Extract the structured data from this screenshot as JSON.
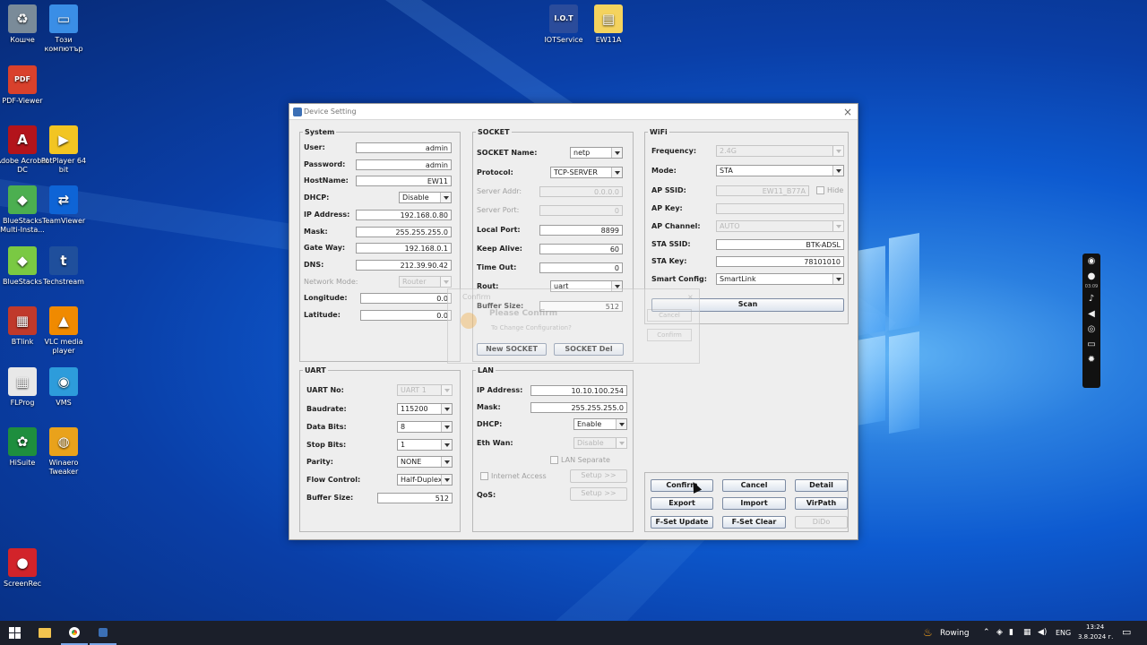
{
  "desktop_icons": [
    {
      "label": "Кошче",
      "color": "#7a8b99",
      "glyph": "♻"
    },
    {
      "label": "Този компютър",
      "color": "#3a8ee6",
      "glyph": "▭"
    },
    {
      "label": "PDF-Viewer",
      "color": "#d9412c",
      "glyph": "PDF"
    },
    {
      "label": "Adobe Acrobat DC",
      "color": "#b3141b",
      "glyph": "A"
    },
    {
      "label": "PotPlayer 64 bit",
      "color": "#f2c522",
      "glyph": "▶"
    },
    {
      "label": "BlueStacks Multi-Insta...",
      "color": "#4caf50",
      "glyph": "◆"
    },
    {
      "label": "TeamViewer",
      "color": "#0e64d6",
      "glyph": "⇄"
    },
    {
      "label": "BlueStacks",
      "color": "#7ac943",
      "glyph": "◆"
    },
    {
      "label": "Techstream",
      "color": "#1f4f9c",
      "glyph": "t"
    },
    {
      "label": "BTlink",
      "color": "#c0392b",
      "glyph": "▦"
    },
    {
      "label": "VLC media player",
      "color": "#f08a00",
      "glyph": "▲"
    },
    {
      "label": "FLProg",
      "color": "#e8e8e8",
      "glyph": "▦"
    },
    {
      "label": "VMS",
      "color": "#2d9cdb",
      "glyph": "◉"
    },
    {
      "label": "HiSuite",
      "color": "#1e8e3e",
      "glyph": "✿"
    },
    {
      "label": "Winaero Tweaker",
      "color": "#e9a21b",
      "glyph": "◍"
    },
    {
      "label": "ScreenRec",
      "color": "#d2232a",
      "glyph": "●"
    },
    {
      "label": "IOTService",
      "color": "#2b4c9b",
      "glyph": "I.O.T"
    },
    {
      "label": "EW11A",
      "color": "#f4d35e",
      "glyph": "▤"
    }
  ],
  "dialog": {
    "title": "Device Setting",
    "system": {
      "title": "System",
      "user_label": "User:",
      "user": "admin",
      "password_label": "Password:",
      "password": "admin",
      "hostname_label": "HostName:",
      "hostname": "EW11",
      "dhcp_label": "DHCP:",
      "dhcp": "Disable",
      "ip_label": "IP Address:",
      "ip": "192.168.0.80",
      "mask_label": "Mask:",
      "mask": "255.255.255.0",
      "gateway_label": "Gate Way:",
      "gateway": "192.168.0.1",
      "dns_label": "DNS:",
      "dns": "212.39.90.42",
      "network_mode_label": "Network Mode:",
      "network_mode": "Router",
      "longitude_label": "Longitude:",
      "longitude": "0.0",
      "latitude_label": "Latitude:",
      "latitude": "0.0"
    },
    "socket": {
      "title": "SOCKET",
      "name_label": "SOCKET Name:",
      "name": "netp",
      "protocol_label": "Protocol:",
      "protocol": "TCP-SERVER",
      "server_addr_label": "Server Addr:",
      "server_addr": "0.0.0.0",
      "server_port_label": "Server Port:",
      "server_port": "0",
      "local_port_label": "Local Port:",
      "local_port": "8899",
      "keep_alive_label": "Keep Alive:",
      "keep_alive": "60",
      "timeout_label": "Time Out:",
      "timeout": "0",
      "rout_label": "Rout:",
      "rout": "uart",
      "buffer_label": "Buffer Size:",
      "buffer": "512",
      "new_btn": "New SOCKET",
      "del_btn": "SOCKET Del"
    },
    "wifi": {
      "title": "WiFi",
      "frequency_label": "Frequency:",
      "frequency": "2.4G",
      "mode_label": "Mode:",
      "mode": "STA",
      "ap_ssid_label": "AP SSID:",
      "ap_ssid": "EW11_B77A",
      "hide_label": "Hide",
      "ap_key_label": "AP Key:",
      "ap_channel_label": "AP Channel:",
      "ap_channel": "AUTO",
      "sta_ssid_label": "STA SSID:",
      "sta_ssid": "BTK-ADSL",
      "sta_key_label": "STA Key:",
      "sta_key": "78101010",
      "smart_label": "Smart Config:",
      "smart": "SmartLink",
      "scan_btn": "Scan"
    },
    "uart": {
      "title": "UART",
      "no_label": "UART No:",
      "no": "UART 1",
      "baud_label": "Baudrate:",
      "baud": "115200",
      "databits_label": "Data Bits:",
      "databits": "8",
      "stopbits_label": "Stop Bits:",
      "stopbits": "1",
      "parity_label": "Parity:",
      "parity": "NONE",
      "flow_label": "Flow Control:",
      "flow": "Half-Duplex",
      "buffer_label": "Buffer Size:",
      "buffer": "512"
    },
    "lan": {
      "title": "LAN",
      "ip_label": "IP Address:",
      "ip": "10.10.100.254",
      "mask_label": "Mask:",
      "mask": "255.255.255.0",
      "dhcp_label": "DHCP:",
      "dhcp": "Enable",
      "ethwan_label": "Eth Wan:",
      "ethwan": "Disable",
      "lan_sep_label": "LAN Separate",
      "internet_label": "Internet Access",
      "setup1": "Setup >>",
      "qos_label": "QoS:",
      "setup2": "Setup >>"
    },
    "actions": {
      "confirm": "Confirm",
      "cancel": "Cancel",
      "detail": "Detail",
      "export": "Export",
      "import": "Import",
      "virpath": "VirPath",
      "fset_update": "F-Set Update",
      "fset_clear": "F-Set Clear",
      "dido": "DiDo"
    },
    "ghost_popup": {
      "title": "Confirm",
      "heading": "Please Confirm",
      "message": "To Change Configuration?",
      "cancel": "Cancel",
      "confirm": "Confirm"
    }
  },
  "sidebar": {
    "time": "03:09"
  },
  "taskbar": {
    "weather": "Rowing",
    "lang": "ENG",
    "time": "13:24",
    "date": "3.8.2024 г."
  }
}
